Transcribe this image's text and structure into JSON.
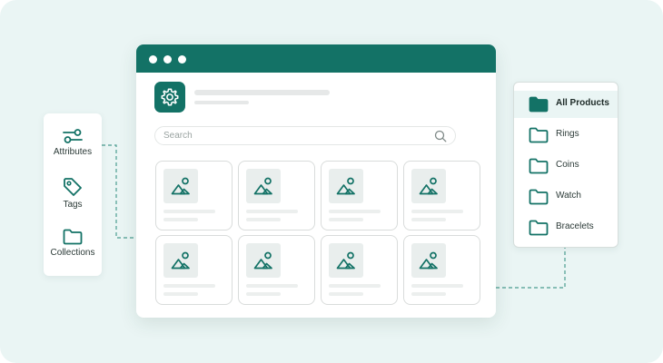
{
  "colors": {
    "background": "#eaf5f4",
    "accent": "#137266",
    "card_border": "#d9dcdb",
    "text": "#2b3a37"
  },
  "window": {
    "traffic_dots": 3,
    "app_icon": "gear-icon",
    "search": {
      "placeholder": "Search",
      "value": "",
      "icon": "search-icon"
    },
    "product_cards": 8,
    "card_icon": "image-icon"
  },
  "left_panel": {
    "items": [
      {
        "label": "Attributes",
        "icon": "sliders-icon"
      },
      {
        "label": "Tags",
        "icon": "tag-icon"
      },
      {
        "label": "Collections",
        "icon": "folder-icon"
      }
    ]
  },
  "right_panel": {
    "items": [
      {
        "label": "All Products",
        "icon": "folder-filled-icon",
        "active": true
      },
      {
        "label": "Rings",
        "icon": "folder-icon",
        "active": false
      },
      {
        "label": "Coins",
        "icon": "folder-icon",
        "active": false
      },
      {
        "label": "Watch",
        "icon": "folder-icon",
        "active": false
      },
      {
        "label": "Bracelets",
        "icon": "folder-icon",
        "active": false
      }
    ]
  }
}
